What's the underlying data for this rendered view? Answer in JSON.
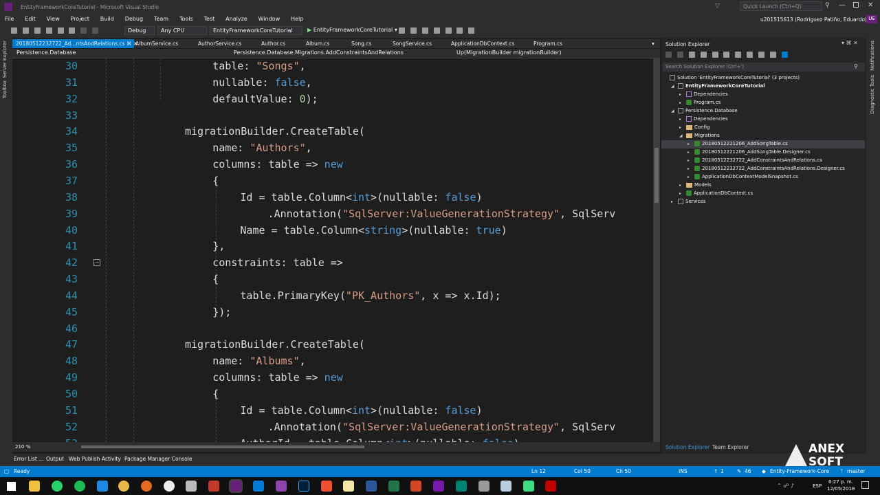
{
  "window": {
    "title": "EntityFrameworkCoreTutorial - Microsoft Visual Studio",
    "quick_launch": "Quick Launch (Ctrl+Q)",
    "user": "u201515613 (Rodriguez Patiño, Eduardo)",
    "user_initials": "UE"
  },
  "menu": [
    "File",
    "Edit",
    "View",
    "Project",
    "Build",
    "Debug",
    "Team",
    "Tools",
    "Test",
    "Analyze",
    "Window",
    "Help"
  ],
  "toolbar": {
    "config": "Debug",
    "platform": "Any CPU",
    "startup_project": "EntityFrameworkCoreTutorial",
    "run_label": "EntityFrameworkCoreTutorial"
  },
  "left_tools": [
    "Server Explorer",
    "Toolbox"
  ],
  "right_tools": [
    "Notifications",
    "Diagnostic Tools"
  ],
  "tabs": [
    "20180512232722_Ad...ntsAndRelations.cs",
    "AlbumService.cs",
    "AuthorService.cs",
    "Author.cs",
    "Album.cs",
    "Song.cs",
    "SongService.cs",
    "ApplicationDbContext.cs",
    "Program.cs"
  ],
  "navbar": {
    "project": "Persistence.Database",
    "class": "Persistence.Database.Migrations.AddConstraintsAndRelations",
    "member": "Up(MigrationBuilder migrationBuilder)"
  },
  "code_lines": [
    {
      "n": "30",
      "t": [
        [
          "table: ",
          "id"
        ],
        [
          "\"Songs\"",
          "str"
        ],
        [
          ",",
          "id"
        ]
      ],
      "i": 3
    },
    {
      "n": "31",
      "t": [
        [
          "nullable: ",
          "id"
        ],
        [
          "false",
          "kw"
        ],
        [
          ",",
          "id"
        ]
      ],
      "i": 3
    },
    {
      "n": "32",
      "t": [
        [
          "defaultValue: ",
          "id"
        ],
        [
          "0",
          "num"
        ],
        [
          ");",
          "id"
        ]
      ],
      "i": 3
    },
    {
      "n": "33",
      "t": [],
      "i": 0
    },
    {
      "n": "34",
      "t": [
        [
          "migrationBuilder.CreateTable(",
          "id"
        ]
      ],
      "i": 2
    },
    {
      "n": "35",
      "t": [
        [
          "name: ",
          "id"
        ],
        [
          "\"Authors\"",
          "str"
        ],
        [
          ",",
          "id"
        ]
      ],
      "i": 3
    },
    {
      "n": "36",
      "t": [
        [
          "columns: table => ",
          "id"
        ],
        [
          "new",
          "kw"
        ]
      ],
      "i": 3
    },
    {
      "n": "37",
      "t": [
        [
          "{",
          "id"
        ]
      ],
      "i": 3
    },
    {
      "n": "38",
      "t": [
        [
          "Id = table.Column<",
          "id"
        ],
        [
          "int",
          "kw"
        ],
        [
          ">(nullable: ",
          "id"
        ],
        [
          "false",
          "kw"
        ],
        [
          ")",
          "id"
        ]
      ],
      "i": 4
    },
    {
      "n": "39",
      "t": [
        [
          ".Annotation(",
          "id"
        ],
        [
          "\"SqlServer:ValueGenerationStrategy\"",
          "str"
        ],
        [
          ", SqlServ",
          "id"
        ]
      ],
      "i": 5
    },
    {
      "n": "40",
      "t": [
        [
          "Name = table.Column<",
          "id"
        ],
        [
          "string",
          "kw"
        ],
        [
          ">(nullable: ",
          "id"
        ],
        [
          "true",
          "kw"
        ],
        [
          ")",
          "id"
        ]
      ],
      "i": 4
    },
    {
      "n": "41",
      "t": [
        [
          "},",
          "id"
        ]
      ],
      "i": 3
    },
    {
      "n": "42",
      "t": [
        [
          "constraints: table =>",
          "id"
        ]
      ],
      "i": 3
    },
    {
      "n": "43",
      "t": [
        [
          "{",
          "id"
        ]
      ],
      "i": 3
    },
    {
      "n": "44",
      "t": [
        [
          "table.PrimaryKey(",
          "id"
        ],
        [
          "\"PK_Authors\"",
          "str"
        ],
        [
          ", x => x.Id);",
          "id"
        ]
      ],
      "i": 4
    },
    {
      "n": "45",
      "t": [
        [
          "});",
          "id"
        ]
      ],
      "i": 3
    },
    {
      "n": "46",
      "t": [],
      "i": 0
    },
    {
      "n": "47",
      "t": [
        [
          "migrationBuilder.CreateTable(",
          "id"
        ]
      ],
      "i": 2
    },
    {
      "n": "48",
      "t": [
        [
          "name: ",
          "id"
        ],
        [
          "\"Albums\"",
          "str"
        ],
        [
          ",",
          "id"
        ]
      ],
      "i": 3
    },
    {
      "n": "49",
      "t": [
        [
          "columns: table => ",
          "id"
        ],
        [
          "new",
          "kw"
        ]
      ],
      "i": 3
    },
    {
      "n": "50",
      "t": [
        [
          "{",
          "id"
        ]
      ],
      "i": 3
    },
    {
      "n": "51",
      "t": [
        [
          "Id = table.Column<",
          "id"
        ],
        [
          "int",
          "kw"
        ],
        [
          ">(nullable: ",
          "id"
        ],
        [
          "false",
          "kw"
        ],
        [
          ")",
          "id"
        ]
      ],
      "i": 4
    },
    {
      "n": "52",
      "t": [
        [
          ".Annotation(",
          "id"
        ],
        [
          "\"SqlServer:ValueGenerationStrategy\"",
          "str"
        ],
        [
          ", SqlServ",
          "id"
        ]
      ],
      "i": 5
    },
    {
      "n": "53",
      "t": [
        [
          "AuthorId = table.Column<",
          "id"
        ],
        [
          "int",
          "kw"
        ],
        [
          ">(nullable: ",
          "id"
        ],
        [
          "false",
          "kw"
        ],
        [
          ")",
          "id"
        ]
      ],
      "i": 4
    }
  ],
  "solution_explorer": {
    "title": "Solution Explorer",
    "search_placeholder": "Search Solution Explorer (Ctrl+')",
    "items": [
      {
        "label": "Solution 'EntityFrameworkCoreTutorial' (3 projects)",
        "lvl": 0,
        "kind": "sln",
        "exp": ""
      },
      {
        "label": "EntityFrameworkCoreTutorial",
        "lvl": 1,
        "kind": "proj",
        "exp": "open",
        "bold": true
      },
      {
        "label": "Dependencies",
        "lvl": 2,
        "kind": "dep",
        "exp": "closed"
      },
      {
        "label": "Program.cs",
        "lvl": 2,
        "kind": "cs",
        "exp": "closed"
      },
      {
        "label": "Persistence.Database",
        "lvl": 1,
        "kind": "proj",
        "exp": "open"
      },
      {
        "label": "Dependencies",
        "lvl": 2,
        "kind": "dep",
        "exp": "closed"
      },
      {
        "label": "Config",
        "lvl": 2,
        "kind": "folder",
        "exp": "closed"
      },
      {
        "label": "Migrations",
        "lvl": 2,
        "kind": "folder",
        "exp": "open"
      },
      {
        "label": "20180512221206_AddSongTable.cs",
        "lvl": 3,
        "kind": "cs",
        "exp": "closed",
        "selected": true
      },
      {
        "label": "20180512221206_AddSongTable.Designer.cs",
        "lvl": 3,
        "kind": "cs",
        "exp": "closed"
      },
      {
        "label": "20180512232722_AddConstraintsAndRelations.cs",
        "lvl": 3,
        "kind": "cs",
        "exp": "closed"
      },
      {
        "label": "20180512232722_AddConstraintsAndRelations.Designer.cs",
        "lvl": 3,
        "kind": "cs",
        "exp": "closed"
      },
      {
        "label": "ApplicationDbContextModelSnapshot.cs",
        "lvl": 3,
        "kind": "cs",
        "exp": "closed"
      },
      {
        "label": "Models",
        "lvl": 2,
        "kind": "folder",
        "exp": "closed"
      },
      {
        "label": "ApplicationDbContext.cs",
        "lvl": 2,
        "kind": "cs",
        "exp": "closed"
      },
      {
        "label": "Services",
        "lvl": 1,
        "kind": "proj",
        "exp": "closed"
      }
    ],
    "footer_tabs": [
      "Solution Explorer",
      "Team Explorer"
    ]
  },
  "editor": {
    "zoom": "210 %"
  },
  "bottom_tabs": [
    "Error List ...",
    "Output",
    "Web Publish Activity",
    "Package Manager Console"
  ],
  "status": {
    "state": "Ready",
    "ln": "Ln 12",
    "col": "Col 50",
    "ch": "Ch 50",
    "mode": "INS",
    "up": "1",
    "edits": "46",
    "repo": "Entity-Framework-Core",
    "branch": "master"
  },
  "tray": {
    "lang": "ESP",
    "time": "6:27 p. m.",
    "date": "12/05/2018"
  },
  "watermark": "ANEX SOFT"
}
